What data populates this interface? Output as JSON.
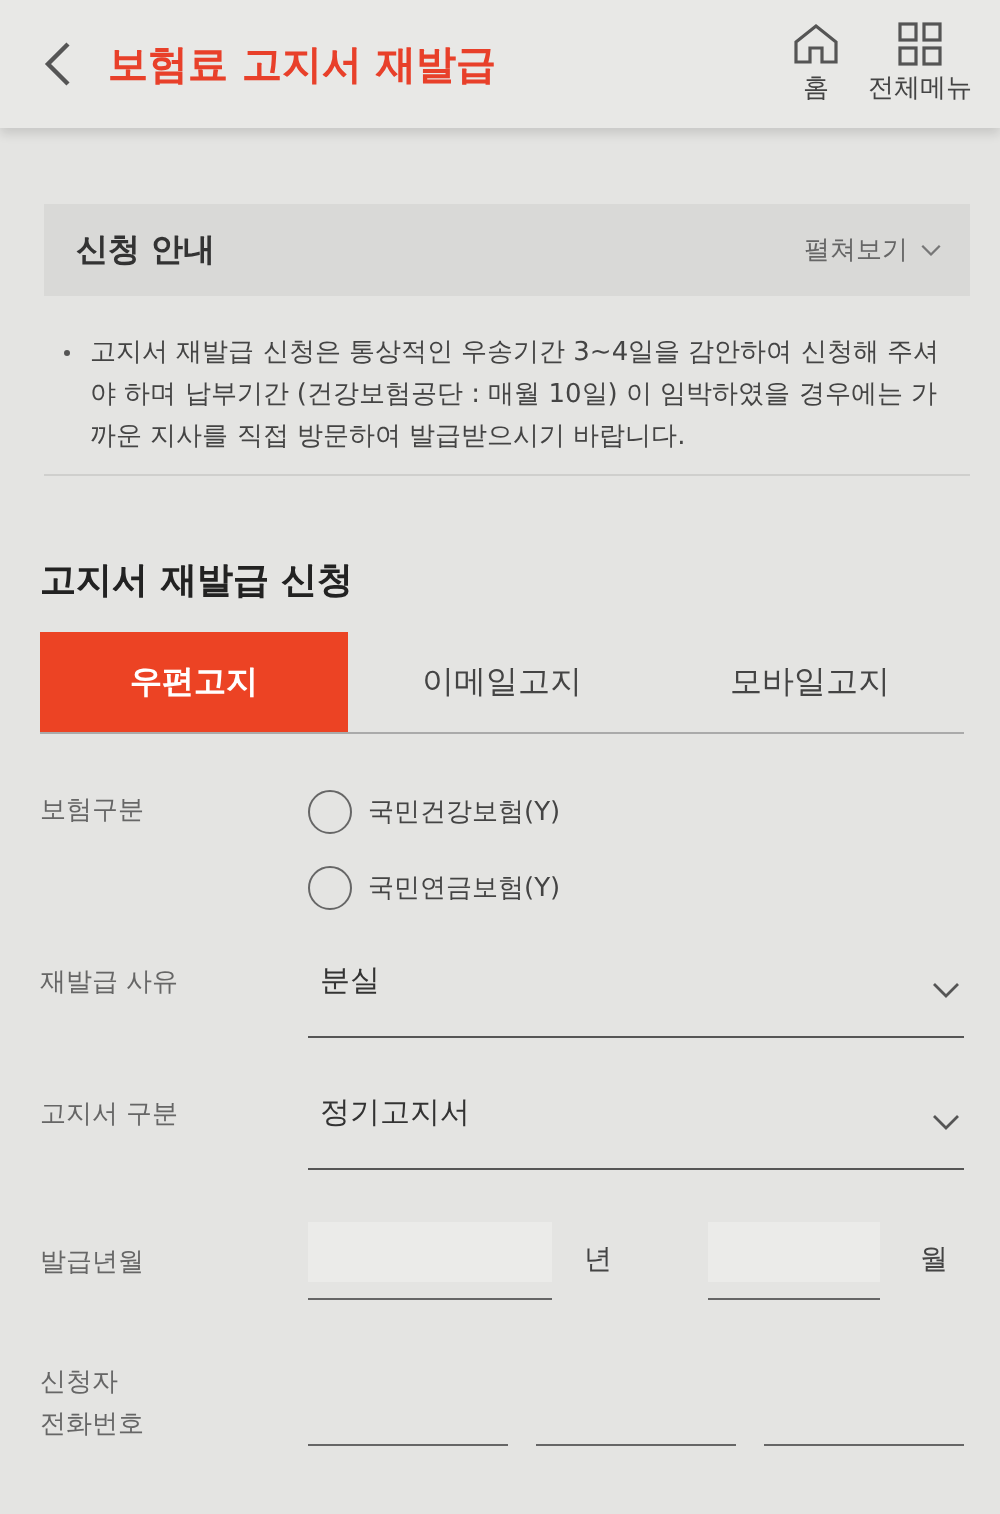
{
  "header": {
    "title": "보험료 고지서 재발급",
    "nav_items": [
      {
        "kind": "home",
        "label": "홈"
      },
      {
        "kind": "menu",
        "label": "전체메뉴"
      }
    ]
  },
  "notice": {
    "title": "신청 안내",
    "toggle_label": "펼쳐보기",
    "text": "고지서 재발급 신청은 통상적인 우송기간 3~4일을 감안하여 신청해 주셔야 하며 납부기간 (건강보험공단 : 매월 10일) 이 임박하였을 경우에는 가까운 지사를 직접 방문하여 발급받으시기 바랍니다."
  },
  "form": {
    "title": "고지서 재발급 신청",
    "tabs": [
      {
        "label": "우편고지",
        "selected": true
      },
      {
        "label": "이메일고지",
        "selected": false
      },
      {
        "label": "모바일고지",
        "selected": false
      }
    ],
    "fields": [
      {
        "kind": "radio_group",
        "label": "보험구분",
        "options": [
          {
            "label": "국민건강보험(Y)",
            "selected": false
          },
          {
            "label": "국민연금보험(Y)",
            "selected": false
          }
        ]
      },
      {
        "kind": "select",
        "label": "재발급 사유",
        "value": "분실"
      },
      {
        "kind": "select",
        "label": "고지서 구분",
        "value": "정기고지서"
      },
      {
        "kind": "year_month",
        "label": "발급년월",
        "year_unit": "년",
        "month_unit": "월"
      },
      {
        "kind": "phone",
        "label": "신청자\n전화번호"
      }
    ]
  }
}
